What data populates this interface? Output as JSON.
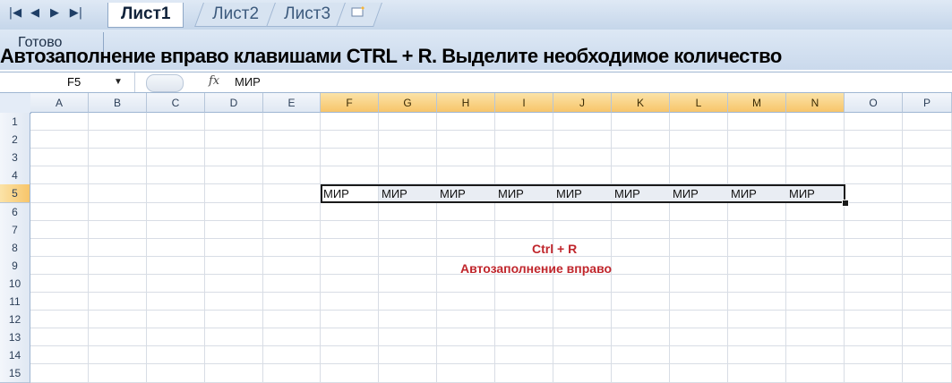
{
  "sheet_tabs": {
    "nav": [
      "|◀",
      "◀",
      "▶",
      "▶|"
    ],
    "tabs": [
      "Лист1",
      "Лист2",
      "Лист3"
    ],
    "active_tab": "Лист1"
  },
  "status": {
    "text": "Готово"
  },
  "overlay_title": "Автозаполнение вправо клавишами CTRL + R. Выделите необходимое количество",
  "formula_bar": {
    "name_box": "F5",
    "fx": "fx",
    "value": "МИР"
  },
  "columns": [
    "A",
    "B",
    "C",
    "D",
    "E",
    "F",
    "G",
    "H",
    "I",
    "J",
    "K",
    "L",
    "M",
    "N",
    "O",
    "P"
  ],
  "selected_columns": [
    "F",
    "G",
    "H",
    "I",
    "J",
    "K",
    "L",
    "M",
    "N"
  ],
  "rows": [
    "1",
    "2",
    "3",
    "4",
    "5",
    "6",
    "7",
    "8",
    "9",
    "10",
    "11",
    "12",
    "13",
    "14",
    "15"
  ],
  "selected_row": "5",
  "row5_values": [
    "МИР",
    "МИР",
    "МИР",
    "МИР",
    "МИР",
    "МИР",
    "МИР",
    "МИР",
    "МИР"
  ],
  "annotation": {
    "line1": "Ctrl + R",
    "line2": "Автозаполнение вправо",
    "color": "#c0262c"
  },
  "colors": {
    "selected_header": "#f7c56a",
    "tab_bar": "#c5d6ea"
  }
}
